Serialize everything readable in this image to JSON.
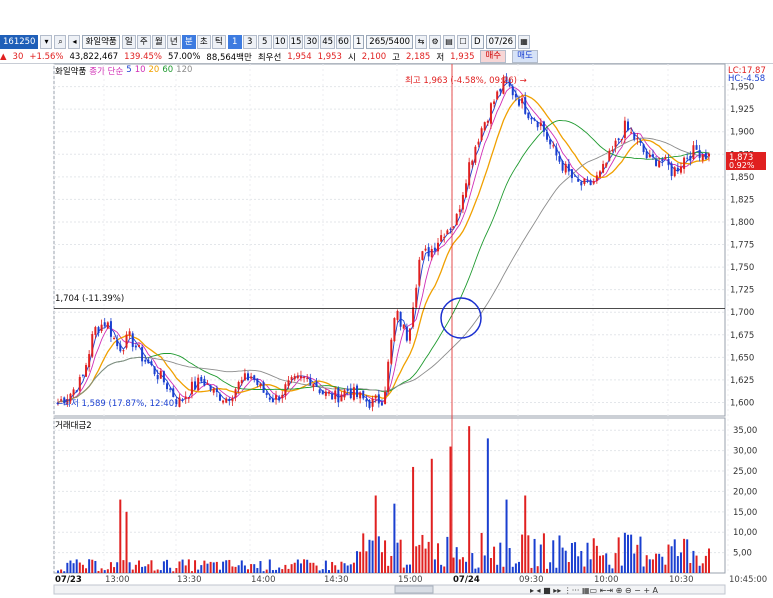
{
  "toolbar": {
    "code": "161250",
    "name": "화일약품",
    "periods": [
      "일",
      "주",
      "월",
      "년",
      "분",
      "초",
      "틱"
    ],
    "active_period": "분",
    "intervals": [
      "1",
      "3",
      "5",
      "10",
      "15",
      "30",
      "45",
      "60"
    ],
    "active_interval": "1",
    "count_value": "1",
    "pages": "265/5400",
    "date_label": "D",
    "date_value": "07/26"
  },
  "quote": {
    "change": "30",
    "change_pct": "+1.56%",
    "volume": "43,822,467",
    "vol_ratio": "139.45%",
    "turnover": "57.00%",
    "amount": "88,564백만",
    "best_label": "최우선",
    "best_ask": "1,954",
    "best_bid": "1,953",
    "open_label": "시",
    "open": "2,100",
    "high_label": "고",
    "high": "2,185",
    "low_label": "저",
    "low": "1,935",
    "buy_label": "매수",
    "sell_label": "매도"
  },
  "price_panel": {
    "legend_name": "화일약품",
    "legend_ma_label": "종가 단순",
    "ma_periods": [
      "5",
      "10",
      "20",
      "60",
      "120"
    ],
    "ma_colors": [
      "#1a3fd0",
      "#d12fb6",
      "#f0a000",
      "#1f9a2f",
      "#8c8c8c"
    ],
    "lc": "LC:17.87",
    "hc": "HC:-4.58",
    "current_price": "1,873",
    "current_pct": "0.92%",
    "high_annot": "최고 1,963 (-4.58%, 09:26) →",
    "low_annot": "←최저 1,589 (17.87%, 12:40)",
    "hline_label": "1,704 (-11.39%)"
  },
  "volume_panel": {
    "legend_name": "거래대금2"
  },
  "chart_data": [
    {
      "type": "candlestick",
      "title": "",
      "y_ticks": [
        "1,950",
        "1,925",
        "1,900",
        "1,875",
        "1,850",
        "1,825",
        "1,800",
        "1,775",
        "1,750",
        "1,725",
        "1,700",
        "1,675",
        "1,650",
        "1,625",
        "1,600"
      ],
      "ylim": [
        1585,
        1975
      ],
      "x_ticks": [
        "07/23",
        "13:00",
        "13:30",
        "14:00",
        "14:30",
        "15:00",
        "07/24",
        "09:30",
        "10:00",
        "10:30",
        "10:45:00"
      ],
      "key_levels": {
        "high": 1963,
        "low": 1589,
        "hline": 1704,
        "last": 1873
      },
      "close_path": [
        1600,
        1610,
        1625,
        1680,
        1690,
        1660,
        1672,
        1650,
        1635,
        1620,
        1600,
        1615,
        1625,
        1610,
        1605,
        1620,
        1630,
        1612,
        1603,
        1618,
        1625,
        1627,
        1610,
        1606,
        1614,
        1605,
        1599,
        1605,
        1700,
        1672,
        1760,
        1770,
        1790,
        1800,
        1860,
        1900,
        1930,
        1955,
        1940,
        1922,
        1910,
        1880,
        1860,
        1842,
        1840,
        1852,
        1878,
        1905,
        1890,
        1868,
        1870,
        1855,
        1872,
        1880,
        1873
      ]
    },
    {
      "type": "bar",
      "title": "",
      "y_ticks": [
        "35,00",
        "30,00",
        "25,00",
        "20,00",
        "15,00",
        "10,00",
        "5,00"
      ],
      "ylim": [
        0,
        38
      ],
      "peak_values": [
        18,
        19,
        17,
        26,
        28,
        31,
        36,
        33
      ]
    }
  ]
}
